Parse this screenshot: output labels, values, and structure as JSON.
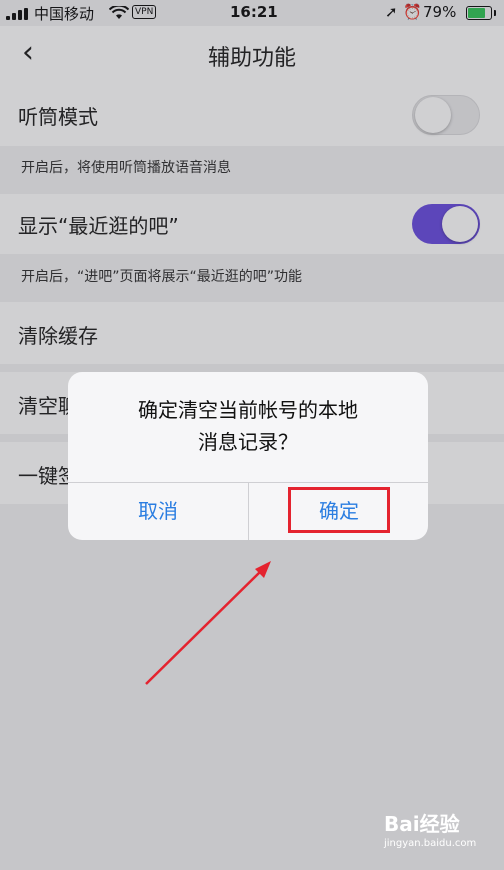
{
  "status": {
    "carrier": "中国移动",
    "vpn": "VPN",
    "time": "16:21",
    "battery": "79%"
  },
  "nav": {
    "back": "‹",
    "title": "辅助功能"
  },
  "settings": [
    {
      "label": "听筒模式",
      "toggle": "off",
      "note": "开启后，将使用听筒播放语音消息"
    },
    {
      "label": "显示“最近逛的吧”",
      "toggle": "on",
      "note": "开启后，“进吧”页面将展示“最近逛的吧”功能"
    },
    {
      "label": "清除缓存"
    },
    {
      "label": "清空聊"
    },
    {
      "label": "一键签"
    }
  ],
  "dialog": {
    "message": "确定清空当前帐号的本地\n消息记录？",
    "cancel": "取消",
    "confirm": "确定"
  },
  "watermark": {
    "logo": "Bai经验",
    "url": "jingyan.baidu.com"
  },
  "colors": {
    "accent": "#6b4fe0",
    "button_blue": "#2a7de1",
    "highlight_red": "#e4232f"
  }
}
